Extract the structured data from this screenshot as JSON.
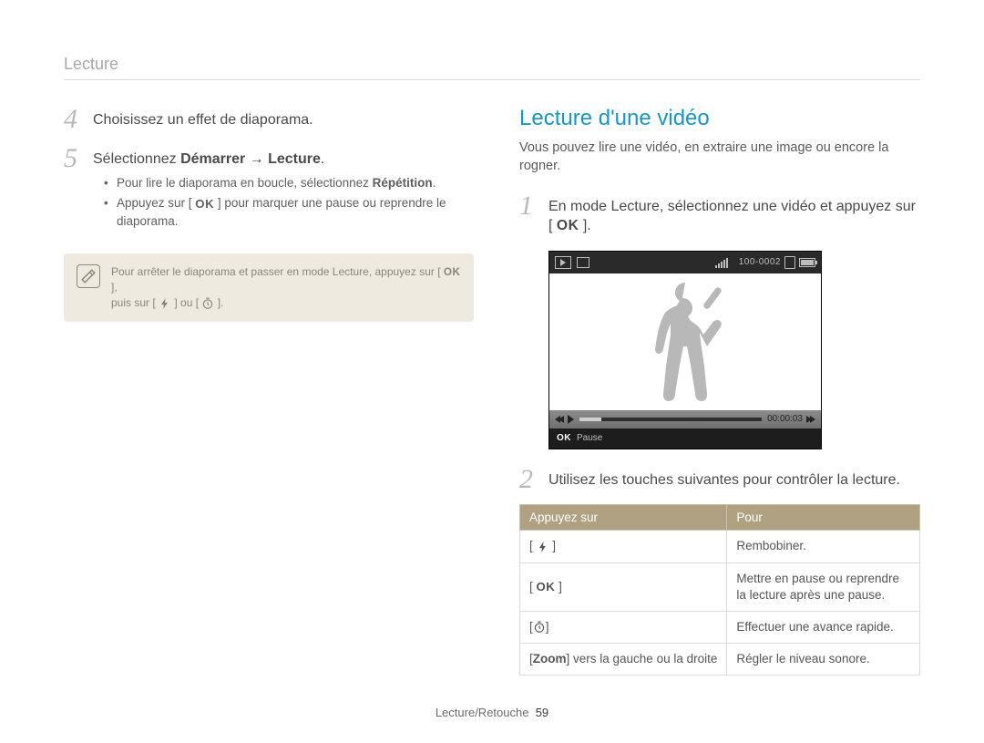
{
  "header": {
    "title": "Lecture"
  },
  "left": {
    "step4": {
      "num": "4",
      "text": "Choisissez un effet de diaporama."
    },
    "step5": {
      "num": "5",
      "text_prefix": "Sélectionnez ",
      "text_bold": "Démarrer → Lecture",
      "text_suffix": ".",
      "bullets": {
        "b1_prefix": "Pour lire le diaporama en boucle, sélectionnez ",
        "b1_bold": "Répétition",
        "b1_suffix": ".",
        "b2_prefix": "Appuyez sur [ ",
        "b2_suffix": " ] pour marquer une pause ou reprendre le diaporama."
      }
    },
    "note": {
      "line1_prefix": "Pour arrêter le diaporama et passer en mode Lecture, appuyez sur [ ",
      "line1_suffix": " ],",
      "line2_prefix": "puis sur [ ",
      "line2_mid": " ] ou [ ",
      "line2_suffix": " ]."
    }
  },
  "right": {
    "title": "Lecture d'une vidéo",
    "intro": "Vous pouvez lire une vidéo, en extraire une image ou encore la rogner.",
    "step1": {
      "num": "1",
      "text_prefix": "En mode Lecture, sélectionnez une vidéo et appuyez sur [ ",
      "text_suffix": " ]."
    },
    "preview": {
      "file_counter": "100-0002",
      "timecode": "00:00:03",
      "footer_ok": "OK",
      "footer_label": "Pause"
    },
    "step2": {
      "num": "2",
      "text": "Utilisez les touches suivantes pour contrôler la lecture."
    },
    "table": {
      "h1": "Appuyez sur",
      "h2": "Pour",
      "r1_key_pre": "[ ",
      "r1_key_post": " ]",
      "r1_val": "Rembobiner.",
      "r2_key_pre": "[ ",
      "r2_ok": "OK",
      "r2_key_post": " ]",
      "r2_val": "Mettre en pause ou reprendre la lecture après une pause.",
      "r3_key_pre": "[",
      "r3_key_post": "]",
      "r3_val": "Effectuer une avance rapide.",
      "r4_key_pre": "[",
      "r4_key_bold": "Zoom",
      "r4_key_mid": "] vers la gauche ou la droite",
      "r4_val": "Régler le niveau sonore."
    }
  },
  "labels": {
    "ok": "OK"
  },
  "footer": {
    "section": "Lecture/Retouche",
    "page": "59"
  }
}
